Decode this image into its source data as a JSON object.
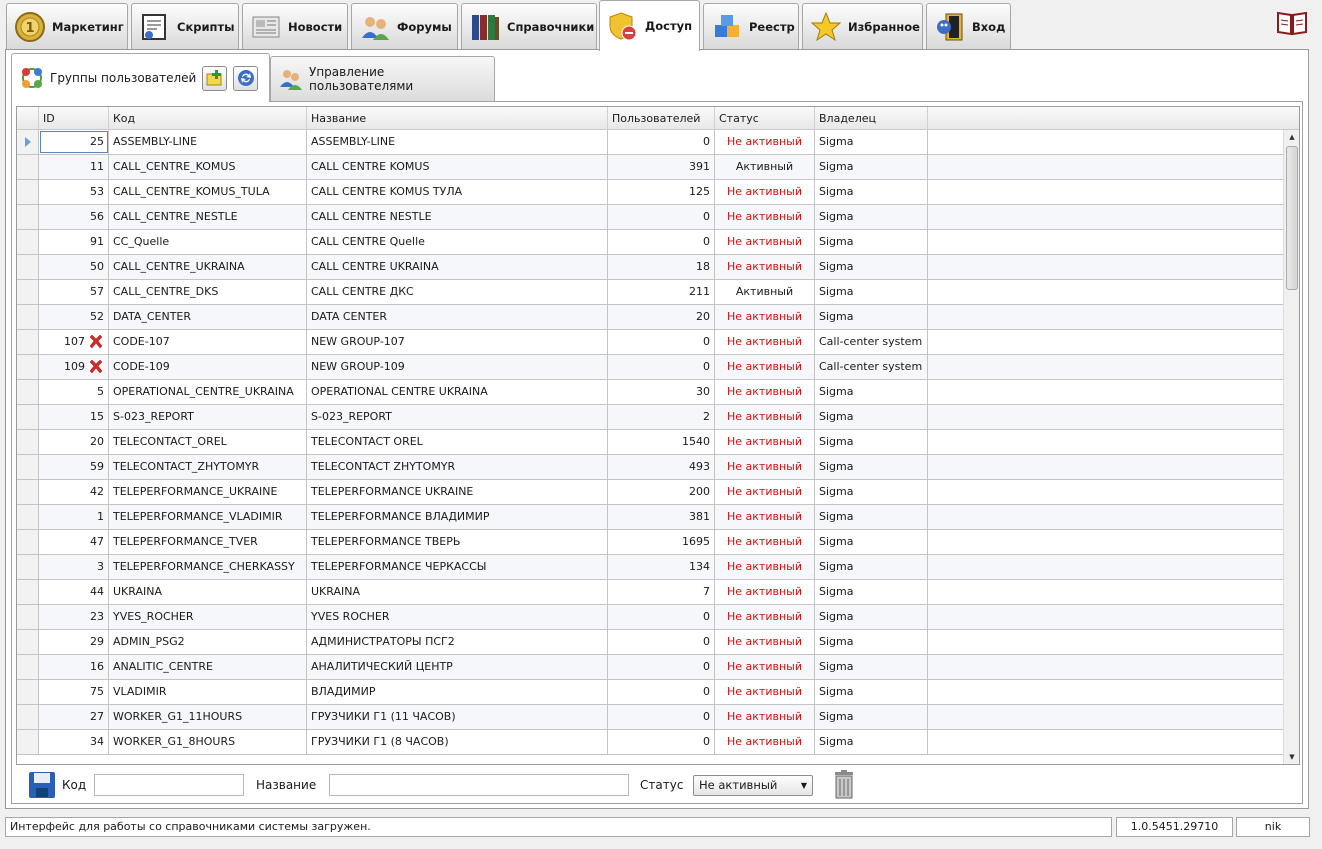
{
  "ribbon": {
    "tabs": [
      {
        "label": "Маркетинг",
        "icon": "coin-icon"
      },
      {
        "label": "Скрипты",
        "icon": "script-icon"
      },
      {
        "label": "Новости",
        "icon": "newspaper-icon"
      },
      {
        "label": "Форумы",
        "icon": "forum-users-icon"
      },
      {
        "label": "Справочники",
        "icon": "books-icon"
      },
      {
        "label": "Доступ",
        "icon": "shield-lock-icon"
      },
      {
        "label": "Реестр",
        "icon": "registry-cubes-icon"
      },
      {
        "label": "Избранное",
        "icon": "star-icon"
      },
      {
        "label": "Вход",
        "icon": "login-door-icon"
      }
    ],
    "active_tab": "Доступ",
    "help_icon": "help-book-icon"
  },
  "subtabs": {
    "groups": {
      "label": "Группы пользователей",
      "icon": "groups-icon"
    },
    "add_button_icon": "add-folder-icon",
    "refresh_button_icon": "refresh-icon",
    "users": {
      "label": "Управление пользователями",
      "icon": "users-management-icon"
    }
  },
  "grid": {
    "columns": {
      "id": "ID",
      "code": "Код",
      "name": "Название",
      "users": "Пользователей",
      "status": "Статус",
      "owner": "Владелец"
    },
    "status_colors": {
      "inactive": "#d01010",
      "active": "#1a1a1a"
    },
    "rows": [
      {
        "id": "25",
        "code": "ASSEMBLY-LINE",
        "name": "ASSEMBLY-LINE",
        "users": "0",
        "status": "Не активный",
        "owner": "Sigma",
        "deleted": false,
        "current": true
      },
      {
        "id": "11",
        "code": "CALL_CENTRE_KOMUS",
        "name": "CALL CENTRE KOMUS",
        "users": "391",
        "status": "Активный",
        "owner": "Sigma",
        "deleted": false
      },
      {
        "id": "53",
        "code": "CALL_CENTRE_KOMUS_TULA",
        "name": "CALL CENTRE KOMUS ТУЛА",
        "users": "125",
        "status": "Не активный",
        "owner": "Sigma",
        "deleted": false
      },
      {
        "id": "56",
        "code": "CALL_CENTRE_NESTLE",
        "name": "CALL CENTRE NESTLE",
        "users": "0",
        "status": "Не активный",
        "owner": "Sigma",
        "deleted": false
      },
      {
        "id": "91",
        "code": "CC_Quelle",
        "name": "CALL CENTRE Quelle",
        "users": "0",
        "status": "Не активный",
        "owner": "Sigma",
        "deleted": false
      },
      {
        "id": "50",
        "code": "CALL_CENTRE_UKRAINA",
        "name": "CALL CENTRE UKRAINA",
        "users": "18",
        "status": "Не активный",
        "owner": "Sigma",
        "deleted": false
      },
      {
        "id": "57",
        "code": "CALL_CENTRE_DKS",
        "name": "CALL CENTRE ДКС",
        "users": "211",
        "status": "Активный",
        "owner": "Sigma",
        "deleted": false
      },
      {
        "id": "52",
        "code": "DATA_CENTER",
        "name": "DATA CENTER",
        "users": "20",
        "status": "Не активный",
        "owner": "Sigma",
        "deleted": false
      },
      {
        "id": "107",
        "code": "CODE-107",
        "name": "NEW GROUP-107",
        "users": "0",
        "status": "Не активный",
        "owner": "Call-center system",
        "deleted": true
      },
      {
        "id": "109",
        "code": "CODE-109",
        "name": "NEW GROUP-109",
        "users": "0",
        "status": "Не активный",
        "owner": "Call-center system",
        "deleted": true
      },
      {
        "id": "5",
        "code": "OPERATIONAL_CENTRE_UKRAINA",
        "name": "OPERATIONAL CENTRE UKRAINA",
        "users": "30",
        "status": "Не активный",
        "owner": "Sigma",
        "deleted": false
      },
      {
        "id": "15",
        "code": "S-023_REPORT",
        "name": "S-023_REPORT",
        "users": "2",
        "status": "Не активный",
        "owner": "Sigma",
        "deleted": false
      },
      {
        "id": "20",
        "code": "TELECONTACT_OREL",
        "name": "TELECONTACT OREL",
        "users": "1540",
        "status": "Не активный",
        "owner": "Sigma",
        "deleted": false
      },
      {
        "id": "59",
        "code": "TELECONTACT_ZHYTOMYR",
        "name": "TELECONTACT ZHYTOMYR",
        "users": "493",
        "status": "Не активный",
        "owner": "Sigma",
        "deleted": false
      },
      {
        "id": "42",
        "code": "TELEPERFORMANCE_UKRAINE",
        "name": "TELEPERFORMANCE UKRAINE",
        "users": "200",
        "status": "Не активный",
        "owner": "Sigma",
        "deleted": false
      },
      {
        "id": "1",
        "code": "TELEPERFORMANCE_VLADIMIR",
        "name": "TELEPERFORMANCE ВЛАДИМИР",
        "users": "381",
        "status": "Не активный",
        "owner": "Sigma",
        "deleted": false
      },
      {
        "id": "47",
        "code": "TELEPERFORMANCE_TVER",
        "name": "TELEPERFORMANCE ТВЕРЬ",
        "users": "1695",
        "status": "Не активный",
        "owner": "Sigma",
        "deleted": false
      },
      {
        "id": "3",
        "code": "TELEPERFORMANCE_CHERKASSY",
        "name": "TELEPERFORMANCE ЧЕРКАССЫ",
        "users": "134",
        "status": "Не активный",
        "owner": "Sigma",
        "deleted": false
      },
      {
        "id": "44",
        "code": "UKRAINA",
        "name": "UKRAINA",
        "users": "7",
        "status": "Не активный",
        "owner": "Sigma",
        "deleted": false
      },
      {
        "id": "23",
        "code": "YVES_ROCHER",
        "name": "YVES ROCHER",
        "users": "0",
        "status": "Не активный",
        "owner": "Sigma",
        "deleted": false
      },
      {
        "id": "29",
        "code": "ADMIN_PSG2",
        "name": "АДМИНИСТРАТОРЫ ПСГ2",
        "users": "0",
        "status": "Не активный",
        "owner": "Sigma",
        "deleted": false
      },
      {
        "id": "16",
        "code": "ANALITIC_CENTRE",
        "name": "АНАЛИТИЧЕСКИЙ ЦЕНТР",
        "users": "0",
        "status": "Не активный",
        "owner": "Sigma",
        "deleted": false
      },
      {
        "id": "75",
        "code": "VLADIMIR",
        "name": "ВЛАДИМИР",
        "users": "0",
        "status": "Не активный",
        "owner": "Sigma",
        "deleted": false
      },
      {
        "id": "27",
        "code": "WORKER_G1_11HOURS",
        "name": "ГРУЗЧИКИ Г1 (11 ЧАСОВ)",
        "users": "0",
        "status": "Не активный",
        "owner": "Sigma",
        "deleted": false
      },
      {
        "id": "34",
        "code": "WORKER_G1_8HOURS",
        "name": "ГРУЗЧИКИ Г1 (8 ЧАСОВ)",
        "users": "0",
        "status": "Не активный",
        "owner": "Sigma",
        "deleted": false
      }
    ]
  },
  "editbar": {
    "save_icon": "save-disk-icon",
    "code_label": "Код",
    "code_value": "",
    "name_label": "Название",
    "name_value": "",
    "status_label": "Статус",
    "status_value": "Не активный",
    "delete_icon": "trash-bin-icon"
  },
  "statusbar": {
    "message": "Интерфейс для работы со справочниками системы загружен.",
    "version": "1.0.5451.29710",
    "user": "nik"
  }
}
